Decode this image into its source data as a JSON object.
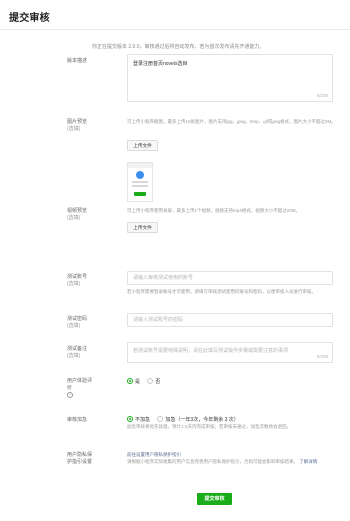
{
  "header": {
    "title": "提交审核"
  },
  "notice": "你正在提交版本 2.0.0，审核通过后将自动发布，若为首次发布请先开通能力。",
  "form": {
    "desc": {
      "label": "版本描述",
      "value": "登录注册首页novels选目",
      "counter": "0/200"
    },
    "screenshot": {
      "label": "图片预览",
      "sublabel": "(选填)",
      "hint": "可上传小程序截图，最多上传10张图片，图片支持jpg、jpeg、bmp、gif或png格式，图片大小不超过2M。",
      "upload_label": "上传文件"
    },
    "video": {
      "label": "视频预览",
      "sublabel": "(选填)",
      "hint": "可上传小程序使用录屏，最多上传1个视频，视频支持mp4格式，视频大小不超过20M。",
      "upload_label": "上传文件"
    },
    "account": {
      "label": "测试账号",
      "sublabel": "(选填)",
      "placeholder": "请输入审核测试使用的账号",
      "hint": "若小程序需要登录账号才可使用，请填写审核测试使用的账号和密码，以便审核人员进行审核。"
    },
    "password": {
      "label": "测试密码",
      "sublabel": "(选填)",
      "placeholder": "请输入测试账号的密码"
    },
    "remark": {
      "label": "测试备注",
      "sublabel": "(选填)",
      "placeholder": "若测试账号需要特殊说明，请在此填写测试操作步骤或需要注意的事项",
      "counter": "0/200"
    },
    "feedback": {
      "label": "用户体验评价",
      "option_yes": "是",
      "option_no": "否",
      "selected": "yes"
    },
    "speed": {
      "label": "审核加急",
      "option_none": "不加急",
      "option_urgent": "加急（一年3次，今年剩余 3 次）",
      "selected": "none",
      "hint": "加急审核将优先处理，预计1-2天内完成审核；若审核未通过，加急次数将会退回。"
    },
    "privacy": {
      "label": "用户隐私保护指引设置",
      "link": "前往设置用户隐私保护指引",
      "hint": "请根据小程序实际收集的用户信息完善用户隐私保护指引，否则可能会影响审核结果。",
      "learn_more": "了解详情"
    }
  },
  "submit_label": "提交审核",
  "colors": {
    "primary": "#1aad19",
    "link": "#576b95"
  }
}
